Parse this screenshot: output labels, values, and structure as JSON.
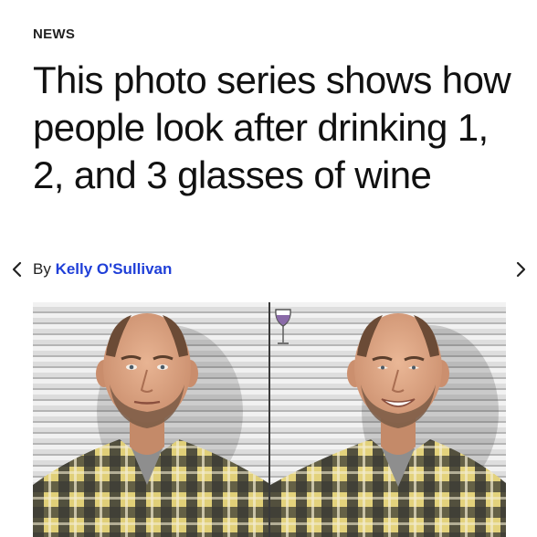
{
  "article": {
    "section": "NEWS",
    "headline": "This photo series shows how people look after drinking 1, 2, and 3 glasses of wine",
    "byline_prefix": "By",
    "author": "Kelly O'Sullivan"
  },
  "photo": {
    "panels": [
      "sober-portrait",
      "one-glass-portrait"
    ],
    "overlay_icon": "wine-glass-icon"
  },
  "icons": {
    "previous": "chevron-left-icon",
    "next": "chevron-right-icon"
  },
  "colors": {
    "author_link": "#1f3fd8",
    "headline_text": "#111111",
    "wine_fill": "#8a6aa8"
  }
}
